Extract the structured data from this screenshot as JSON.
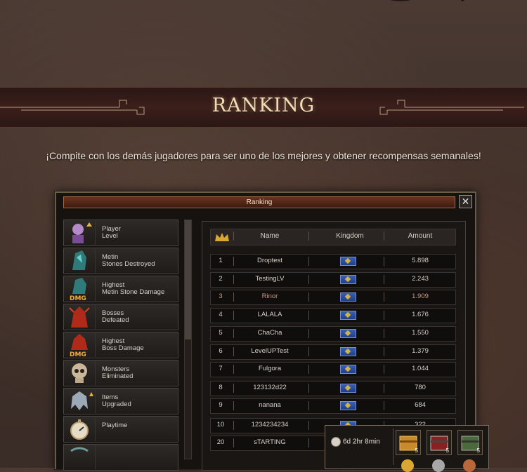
{
  "banner": {
    "title": "RANKING"
  },
  "subtitle": "¡Compite con los demás jugadores para ser uno de los mejores y obtener recompensas semanales!",
  "window": {
    "title": "Ranking",
    "close_label": "✕"
  },
  "sidebar": {
    "items": [
      {
        "label": "Player\nLevel",
        "icon": "player-icon"
      },
      {
        "label": "Metin\nStones Destroyed",
        "icon": "metin-stone-icon"
      },
      {
        "label": "Highest\nMetin Stone Damage",
        "icon": "metin-dmg-icon"
      },
      {
        "label": "Bosses\nDefeated",
        "icon": "boss-icon"
      },
      {
        "label": "Highest\nBoss Damage",
        "icon": "boss-dmg-icon"
      },
      {
        "label": "Monsters\nEliminated",
        "icon": "skull-icon"
      },
      {
        "label": "Items\nUpgraded",
        "icon": "helmet-icon"
      },
      {
        "label": "Playtime",
        "icon": "stopwatch-icon"
      }
    ]
  },
  "table": {
    "columns": [
      "Name",
      "Kingdom",
      "Amount"
    ],
    "rows": [
      {
        "rank": "1",
        "name": "Droptest",
        "amount": "5.898"
      },
      {
        "rank": "2",
        "name": "TestingLV",
        "amount": "2.243"
      },
      {
        "rank": "3",
        "name": "Rinor",
        "amount": "1.909"
      },
      {
        "rank": "4",
        "name": "LALALA",
        "amount": "1.676"
      },
      {
        "rank": "5",
        "name": "ChaCha",
        "amount": "1.550"
      },
      {
        "rank": "6",
        "name": "LevelUPTest",
        "amount": "1.379"
      },
      {
        "rank": "7",
        "name": "Fulgora",
        "amount": "1.044"
      },
      {
        "rank": "8",
        "name": "123132d22",
        "amount": "780"
      },
      {
        "rank": "9",
        "name": "nanana",
        "amount": "684"
      },
      {
        "rank": "10",
        "name": "1234234234",
        "amount": "322"
      },
      {
        "rank": "20",
        "name": "sTARTING",
        "amount": ""
      }
    ]
  },
  "reward": {
    "timer": "6d 2hr 8min",
    "chest_count": "5"
  },
  "colors": {
    "accent": "#f2dcb8",
    "highlight_row": "#c89a7e",
    "kingdom_flag": "#2a4fa0"
  }
}
